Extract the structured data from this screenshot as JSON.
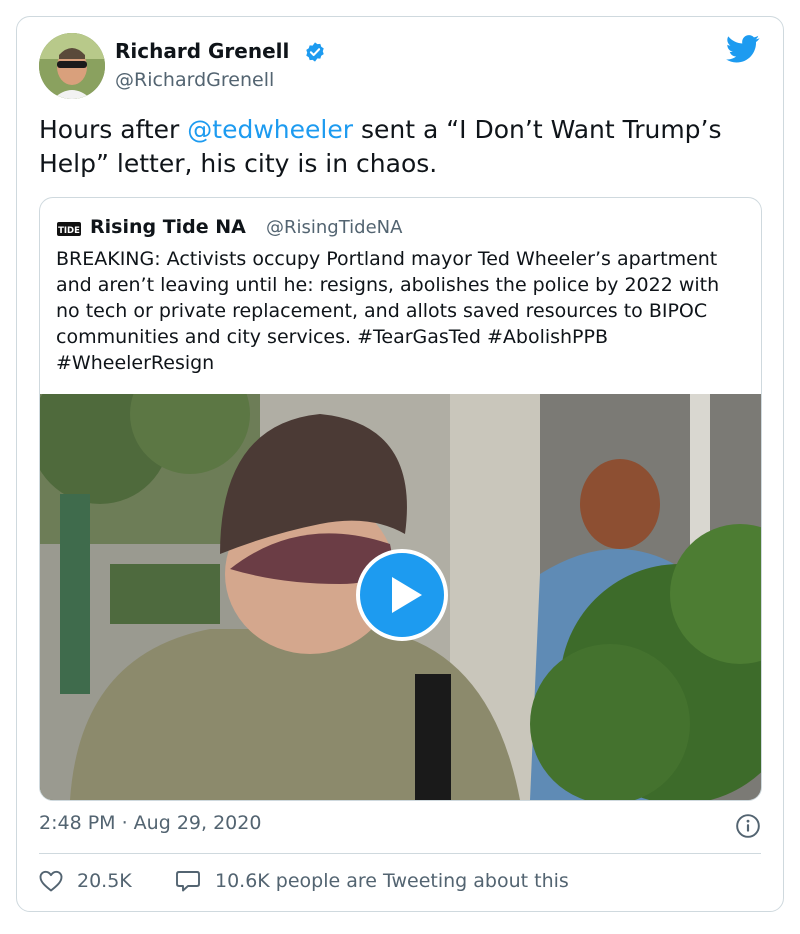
{
  "author": {
    "name": "Richard Grenell",
    "handle": "@RichardGrenell",
    "verified": true
  },
  "tweet": {
    "text_before": "Hours after ",
    "mention": "@tedwheeler",
    "text_after": " sent a “I Don’t Want Trump’s Help” letter, his city is in chaos."
  },
  "quoted": {
    "name": "Rising Tide NA",
    "handle": "@RisingTideNA",
    "avatar_text": "TIDE",
    "text": "BREAKING: Activists occupy Portland mayor Ted Wheeler’s apartment and aren’t leaving until he: resigns, abolishes the police by 2022 with no tech or private replacement, and allots saved resources to BIPOC communities and city services. #TearGasTed #AbolishPPB #WheelerResign"
  },
  "meta": {
    "timestamp": "2:48 PM · Aug 29, 2020"
  },
  "stats": {
    "likes": "20.5K",
    "tweeting": "10.6K people are Tweeting about this"
  },
  "icons": [
    "verified-icon",
    "twitter-bird-icon",
    "play-icon",
    "info-icon",
    "heart-icon",
    "speech-bubble-icon"
  ],
  "colors": {
    "accent": "#1d9bf0",
    "secondary_text": "#536471",
    "border": "#cfd9de"
  }
}
